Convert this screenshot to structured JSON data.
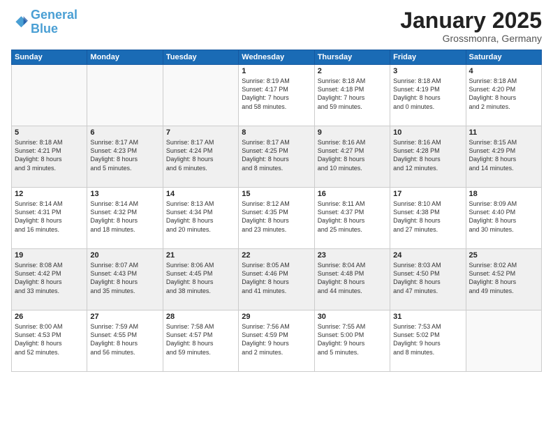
{
  "logo": {
    "line1": "General",
    "line2": "Blue"
  },
  "title": "January 2025",
  "location": "Grossmonra, Germany",
  "headers": [
    "Sunday",
    "Monday",
    "Tuesday",
    "Wednesday",
    "Thursday",
    "Friday",
    "Saturday"
  ],
  "rows": [
    [
      {
        "day": "",
        "lines": []
      },
      {
        "day": "",
        "lines": []
      },
      {
        "day": "",
        "lines": []
      },
      {
        "day": "1",
        "lines": [
          "Sunrise: 8:19 AM",
          "Sunset: 4:17 PM",
          "Daylight: 7 hours",
          "and 58 minutes."
        ]
      },
      {
        "day": "2",
        "lines": [
          "Sunrise: 8:18 AM",
          "Sunset: 4:18 PM",
          "Daylight: 7 hours",
          "and 59 minutes."
        ]
      },
      {
        "day": "3",
        "lines": [
          "Sunrise: 8:18 AM",
          "Sunset: 4:19 PM",
          "Daylight: 8 hours",
          "and 0 minutes."
        ]
      },
      {
        "day": "4",
        "lines": [
          "Sunrise: 8:18 AM",
          "Sunset: 4:20 PM",
          "Daylight: 8 hours",
          "and 2 minutes."
        ]
      }
    ],
    [
      {
        "day": "5",
        "lines": [
          "Sunrise: 8:18 AM",
          "Sunset: 4:21 PM",
          "Daylight: 8 hours",
          "and 3 minutes."
        ]
      },
      {
        "day": "6",
        "lines": [
          "Sunrise: 8:17 AM",
          "Sunset: 4:23 PM",
          "Daylight: 8 hours",
          "and 5 minutes."
        ]
      },
      {
        "day": "7",
        "lines": [
          "Sunrise: 8:17 AM",
          "Sunset: 4:24 PM",
          "Daylight: 8 hours",
          "and 6 minutes."
        ]
      },
      {
        "day": "8",
        "lines": [
          "Sunrise: 8:17 AM",
          "Sunset: 4:25 PM",
          "Daylight: 8 hours",
          "and 8 minutes."
        ]
      },
      {
        "day": "9",
        "lines": [
          "Sunrise: 8:16 AM",
          "Sunset: 4:27 PM",
          "Daylight: 8 hours",
          "and 10 minutes."
        ]
      },
      {
        "day": "10",
        "lines": [
          "Sunrise: 8:16 AM",
          "Sunset: 4:28 PM",
          "Daylight: 8 hours",
          "and 12 minutes."
        ]
      },
      {
        "day": "11",
        "lines": [
          "Sunrise: 8:15 AM",
          "Sunset: 4:29 PM",
          "Daylight: 8 hours",
          "and 14 minutes."
        ]
      }
    ],
    [
      {
        "day": "12",
        "lines": [
          "Sunrise: 8:14 AM",
          "Sunset: 4:31 PM",
          "Daylight: 8 hours",
          "and 16 minutes."
        ]
      },
      {
        "day": "13",
        "lines": [
          "Sunrise: 8:14 AM",
          "Sunset: 4:32 PM",
          "Daylight: 8 hours",
          "and 18 minutes."
        ]
      },
      {
        "day": "14",
        "lines": [
          "Sunrise: 8:13 AM",
          "Sunset: 4:34 PM",
          "Daylight: 8 hours",
          "and 20 minutes."
        ]
      },
      {
        "day": "15",
        "lines": [
          "Sunrise: 8:12 AM",
          "Sunset: 4:35 PM",
          "Daylight: 8 hours",
          "and 23 minutes."
        ]
      },
      {
        "day": "16",
        "lines": [
          "Sunrise: 8:11 AM",
          "Sunset: 4:37 PM",
          "Daylight: 8 hours",
          "and 25 minutes."
        ]
      },
      {
        "day": "17",
        "lines": [
          "Sunrise: 8:10 AM",
          "Sunset: 4:38 PM",
          "Daylight: 8 hours",
          "and 27 minutes."
        ]
      },
      {
        "day": "18",
        "lines": [
          "Sunrise: 8:09 AM",
          "Sunset: 4:40 PM",
          "Daylight: 8 hours",
          "and 30 minutes."
        ]
      }
    ],
    [
      {
        "day": "19",
        "lines": [
          "Sunrise: 8:08 AM",
          "Sunset: 4:42 PM",
          "Daylight: 8 hours",
          "and 33 minutes."
        ]
      },
      {
        "day": "20",
        "lines": [
          "Sunrise: 8:07 AM",
          "Sunset: 4:43 PM",
          "Daylight: 8 hours",
          "and 35 minutes."
        ]
      },
      {
        "day": "21",
        "lines": [
          "Sunrise: 8:06 AM",
          "Sunset: 4:45 PM",
          "Daylight: 8 hours",
          "and 38 minutes."
        ]
      },
      {
        "day": "22",
        "lines": [
          "Sunrise: 8:05 AM",
          "Sunset: 4:46 PM",
          "Daylight: 8 hours",
          "and 41 minutes."
        ]
      },
      {
        "day": "23",
        "lines": [
          "Sunrise: 8:04 AM",
          "Sunset: 4:48 PM",
          "Daylight: 8 hours",
          "and 44 minutes."
        ]
      },
      {
        "day": "24",
        "lines": [
          "Sunrise: 8:03 AM",
          "Sunset: 4:50 PM",
          "Daylight: 8 hours",
          "and 47 minutes."
        ]
      },
      {
        "day": "25",
        "lines": [
          "Sunrise: 8:02 AM",
          "Sunset: 4:52 PM",
          "Daylight: 8 hours",
          "and 49 minutes."
        ]
      }
    ],
    [
      {
        "day": "26",
        "lines": [
          "Sunrise: 8:00 AM",
          "Sunset: 4:53 PM",
          "Daylight: 8 hours",
          "and 52 minutes."
        ]
      },
      {
        "day": "27",
        "lines": [
          "Sunrise: 7:59 AM",
          "Sunset: 4:55 PM",
          "Daylight: 8 hours",
          "and 56 minutes."
        ]
      },
      {
        "day": "28",
        "lines": [
          "Sunrise: 7:58 AM",
          "Sunset: 4:57 PM",
          "Daylight: 8 hours",
          "and 59 minutes."
        ]
      },
      {
        "day": "29",
        "lines": [
          "Sunrise: 7:56 AM",
          "Sunset: 4:59 PM",
          "Daylight: 9 hours",
          "and 2 minutes."
        ]
      },
      {
        "day": "30",
        "lines": [
          "Sunrise: 7:55 AM",
          "Sunset: 5:00 PM",
          "Daylight: 9 hours",
          "and 5 minutes."
        ]
      },
      {
        "day": "31",
        "lines": [
          "Sunrise: 7:53 AM",
          "Sunset: 5:02 PM",
          "Daylight: 9 hours",
          "and 8 minutes."
        ]
      },
      {
        "day": "",
        "lines": []
      }
    ]
  ]
}
